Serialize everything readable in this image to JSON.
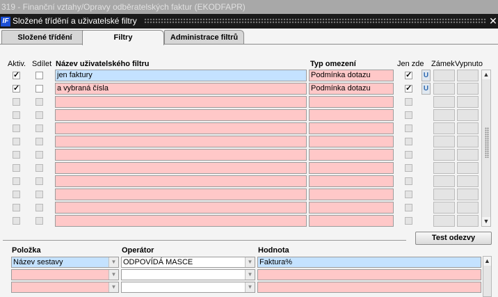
{
  "window": {
    "bg_title": "319 - Finanční vztahy/Opravy odběratelských faktur (EKODFAPR)",
    "dialog_title": "Složené třídění a uživatelské filtry",
    "app_icon": "IF"
  },
  "tabs": [
    {
      "label": "Složené třídění",
      "active": false
    },
    {
      "label": "Filtry",
      "active": true
    },
    {
      "label": "Administrace filtrů",
      "active": false
    }
  ],
  "filters_grid": {
    "headers": {
      "active": "Aktiv.",
      "share": "Sdílet",
      "name": "Název uživatelského filtru",
      "type": "Typ omezení",
      "only_here": "Jen zde",
      "lock": "Zámek",
      "off": "Vypnuto"
    },
    "u_label": "U",
    "rows": [
      {
        "active": true,
        "share": false,
        "name": "jen faktury",
        "type": "Podmínka dotazu",
        "only_here": true,
        "u": true,
        "selected": true
      },
      {
        "active": true,
        "share": false,
        "name": "a vybraná čísla",
        "type": "Podmínka dotazu",
        "only_here": true,
        "u": true,
        "selected": false
      },
      {
        "active": false,
        "share": false,
        "name": "",
        "type": "",
        "only_here": false,
        "u": false,
        "selected": false
      },
      {
        "active": false,
        "share": false,
        "name": "",
        "type": "",
        "only_here": false,
        "u": false,
        "selected": false
      },
      {
        "active": false,
        "share": false,
        "name": "",
        "type": "",
        "only_here": false,
        "u": false,
        "selected": false
      },
      {
        "active": false,
        "share": false,
        "name": "",
        "type": "",
        "only_here": false,
        "u": false,
        "selected": false
      },
      {
        "active": false,
        "share": false,
        "name": "",
        "type": "",
        "only_here": false,
        "u": false,
        "selected": false
      },
      {
        "active": false,
        "share": false,
        "name": "",
        "type": "",
        "only_here": false,
        "u": false,
        "selected": false
      },
      {
        "active": false,
        "share": false,
        "name": "",
        "type": "",
        "only_here": false,
        "u": false,
        "selected": false
      },
      {
        "active": false,
        "share": false,
        "name": "",
        "type": "",
        "only_here": false,
        "u": false,
        "selected": false
      },
      {
        "active": false,
        "share": false,
        "name": "",
        "type": "",
        "only_here": false,
        "u": false,
        "selected": false
      },
      {
        "active": false,
        "share": false,
        "name": "",
        "type": "",
        "only_here": false,
        "u": false,
        "selected": false
      }
    ]
  },
  "test_button": "Test odezvy",
  "conditions": {
    "headers": {
      "item": "Položka",
      "operator": "Operátor",
      "value": "Hodnota"
    },
    "rows": [
      {
        "item": "Název sestavy",
        "operator": "ODPOVÍDÁ MASCE",
        "value": "Faktura%",
        "selected": true
      },
      {
        "item": "",
        "operator": "",
        "value": "",
        "selected": false
      },
      {
        "item": "",
        "operator": "",
        "value": "",
        "selected": false
      }
    ]
  },
  "icons": {
    "close": "close-icon",
    "scroll_up": "arrow-up-icon",
    "scroll_down": "arrow-down-icon",
    "dropdown": "chevron-down-icon",
    "check": "checkmark-icon"
  }
}
